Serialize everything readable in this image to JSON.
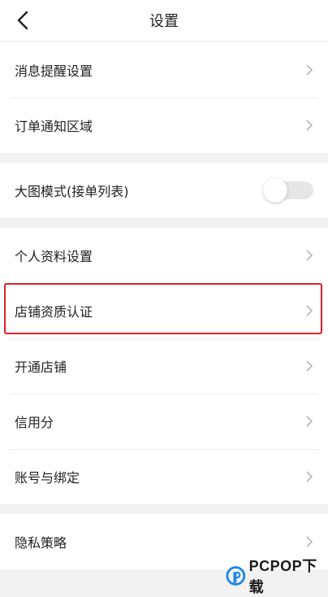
{
  "header": {
    "title": "设置",
    "back_icon": "chevron-left-icon"
  },
  "groups": [
    {
      "rows": [
        {
          "label": "消息提醒设置"
        },
        {
          "label": "订单通知区域"
        }
      ]
    },
    {
      "rows": [
        {
          "label": "大图模式(接单列表)",
          "toggle_on": false
        }
      ]
    },
    {
      "rows": [
        {
          "label": "个人资料设置"
        },
        {
          "label": "店铺资质认证",
          "highlighted": true
        },
        {
          "label": "开通店铺"
        },
        {
          "label": "信用分"
        },
        {
          "label": "账号与绑定"
        }
      ]
    },
    {
      "rows": [
        {
          "label": "隐私策略"
        }
      ]
    }
  ],
  "watermark": {
    "text": "PCPOP下载"
  },
  "colors": {
    "highlight_border": "#e0202a",
    "background": "#f2f2f2",
    "toggle_off": "#e6e6e6"
  }
}
